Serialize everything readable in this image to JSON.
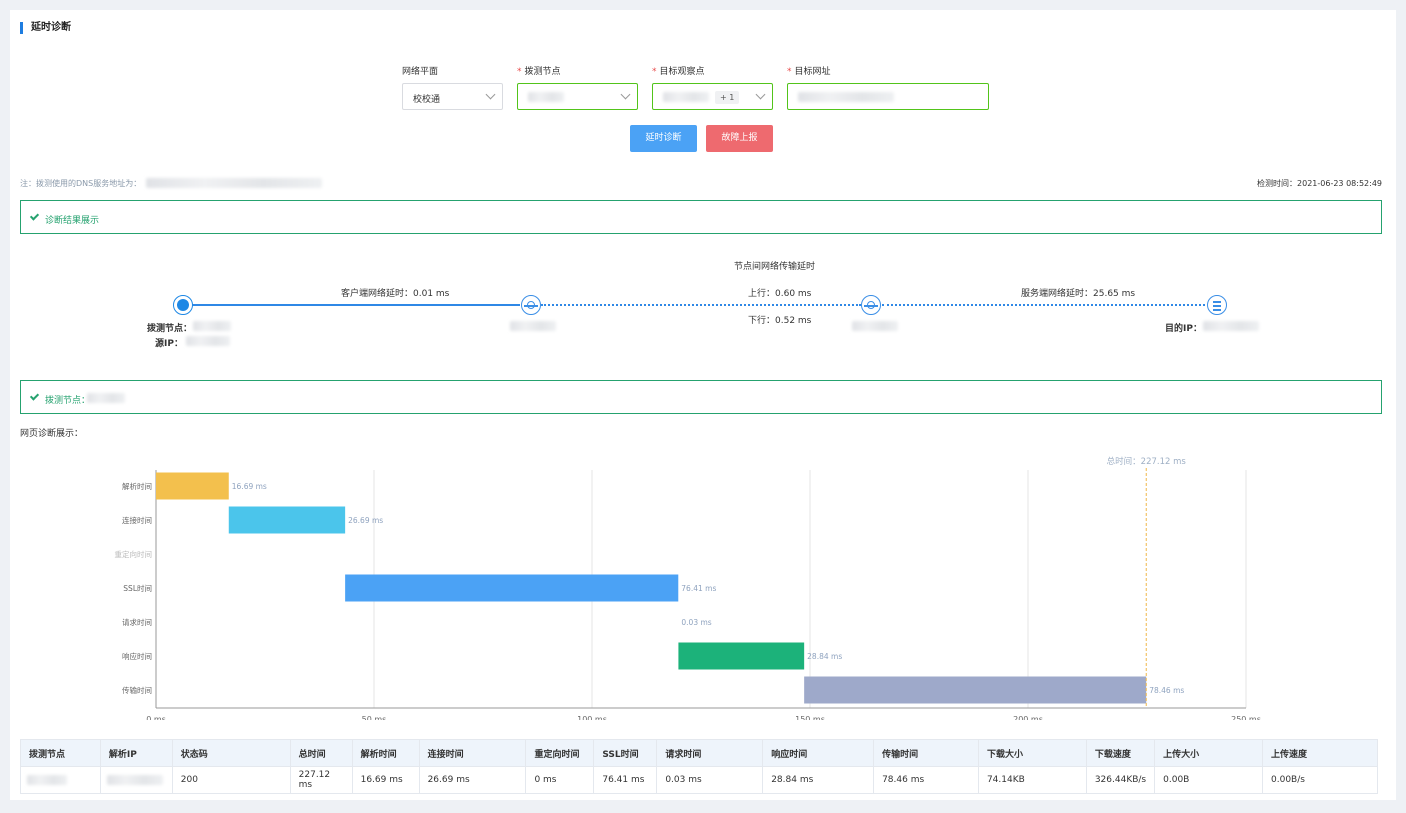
{
  "page": {
    "section_title": "延时诊断"
  },
  "form": {
    "network_plane": {
      "label": "网络平面",
      "value": "校校通"
    },
    "probe_node": {
      "label": "拨测节点",
      "required_mark": "*"
    },
    "target_observe": {
      "label": "目标观察点",
      "required_mark": "*",
      "extra_tag": "+ 1"
    },
    "target_url": {
      "label": "目标网址",
      "required_mark": "*"
    },
    "buttons": {
      "diagnose": "延时诊断",
      "report": "故障上报"
    }
  },
  "note": {
    "text": "注：拨测使用的DNS服务地址为：",
    "detect_time": "检测时间：2021-06-23 08:52:49"
  },
  "result_panel": {
    "title": "诊断结果展示"
  },
  "topology": {
    "header": "节点间网络传输延时",
    "client_latency": "客户端网络延时：0.01 ms",
    "up_latency": "上行：0.60 ms",
    "down_latency": "下行：0.52 ms",
    "server_latency": "服务端网络延时：25.65 ms",
    "probe_node_label": "拨测节点：",
    "source_ip_label": "源IP：",
    "dest_ip_label": "目的IP："
  },
  "probe_panel": {
    "title": "拨测节点："
  },
  "web_diag": {
    "title": "网页诊断展示："
  },
  "chart_data": {
    "type": "bar",
    "subtype": "waterfall",
    "orientation": "horizontal",
    "categories": [
      "解析时间",
      "连接时间",
      "重定向时间",
      "SSL时间",
      "请求时间",
      "响应时间",
      "传输时间"
    ],
    "starts": [
      0,
      16.69,
      43.38,
      43.38,
      119.79,
      119.82,
      148.66
    ],
    "values": [
      16.69,
      26.69,
      0,
      76.41,
      0.03,
      28.84,
      78.46
    ],
    "value_labels": [
      "16.69 ms",
      "26.69 ms",
      "",
      "76.41 ms",
      "0.03 ms",
      "28.84 ms",
      "78.46 ms"
    ],
    "colors": [
      "#f3c04d",
      "#4bc5eb",
      "#cccccc",
      "#4ba2f5",
      "#cccccc",
      "#1cb27a",
      "#9ea9ca"
    ],
    "xlim": [
      0,
      250
    ],
    "xticks": [
      0,
      50,
      100,
      150,
      200,
      250
    ],
    "xtick_labels": [
      "0 ms",
      "50 ms",
      "100 ms",
      "150 ms",
      "200 ms",
      "250 ms"
    ],
    "total_line": {
      "value": 227.12,
      "label": "总时间：227.12 ms"
    },
    "grid": true
  },
  "table": {
    "headers": [
      "拨测节点",
      "解析IP",
      "状态码",
      "总时间",
      "解析时间",
      "连接时间",
      "重定向时间",
      "SSL时间",
      "请求时间",
      "响应时间",
      "传输时间",
      "下载大小",
      "下载速度",
      "上传大小",
      "上传速度"
    ],
    "rows": [
      [
        "",
        "",
        "200",
        "227.12 ms",
        "16.69 ms",
        "26.69 ms",
        "0 ms",
        "76.41 ms",
        "0.03 ms",
        "28.84 ms",
        "78.46 ms",
        "74.14KB",
        "326.44KB/s",
        "0.00B",
        "0.00B/s"
      ]
    ]
  }
}
